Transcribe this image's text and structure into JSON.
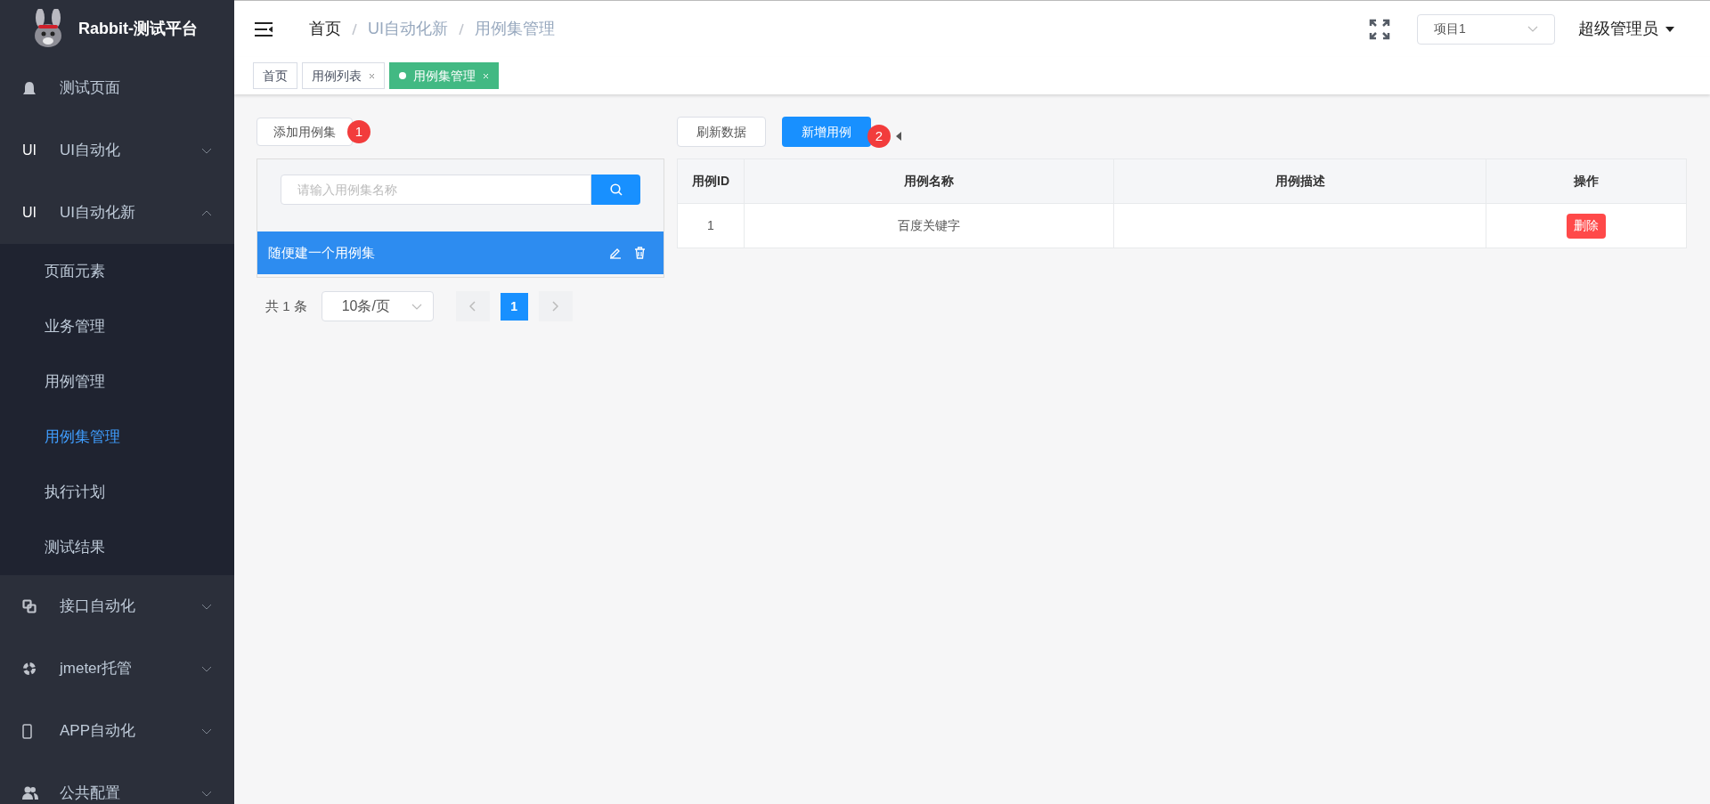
{
  "sidebar": {
    "logo_text": "Rabbit-测试平台",
    "items": [
      {
        "label": "测试页面"
      },
      {
        "label": "UI自动化",
        "icon_text": "UI",
        "expanded": false
      },
      {
        "label": "UI自动化新",
        "icon_text": "UI",
        "expanded": true,
        "children": [
          {
            "label": "页面元素",
            "selected": false
          },
          {
            "label": "业务管理",
            "selected": false
          },
          {
            "label": "用例管理",
            "selected": false
          },
          {
            "label": "用例集管理",
            "selected": true
          },
          {
            "label": "执行计划",
            "selected": false
          },
          {
            "label": "测试结果",
            "selected": false
          }
        ]
      },
      {
        "label": "接口自动化",
        "expanded": false
      },
      {
        "label": "jmeter托管",
        "expanded": false
      },
      {
        "label": "APP自动化",
        "expanded": false
      },
      {
        "label": "公共配置",
        "expanded": false
      }
    ]
  },
  "header": {
    "breadcrumb": [
      "首页",
      "UI自动化新",
      "用例集管理"
    ],
    "project_select": "项目1",
    "user": "超级管理员"
  },
  "tabs": [
    {
      "label": "首页",
      "selected": false,
      "closable": false
    },
    {
      "label": "用例列表",
      "selected": false,
      "closable": true
    },
    {
      "label": "用例集管理",
      "selected": true,
      "closable": true
    }
  ],
  "left_panel": {
    "add_button": "添加用例集",
    "step_badge": "1",
    "search": {
      "placeholder": "请输入用例集名称"
    },
    "suites": [
      {
        "name": "随便建一个用例集",
        "selected": true
      }
    ],
    "pagination": {
      "total": "共 1 条",
      "page_size": "10条/页",
      "pages": [
        {
          "label": "1",
          "selected": true
        }
      ]
    }
  },
  "right_panel": {
    "refresh_button": "刷新数据",
    "new_button": "新增用例",
    "step_badge": "2",
    "table": {
      "columns": [
        "用例ID",
        "用例名称",
        "用例描述",
        "操作"
      ],
      "rows": [
        {
          "id": "1",
          "name": "百度关键字",
          "action": "删除"
        }
      ]
    }
  }
}
